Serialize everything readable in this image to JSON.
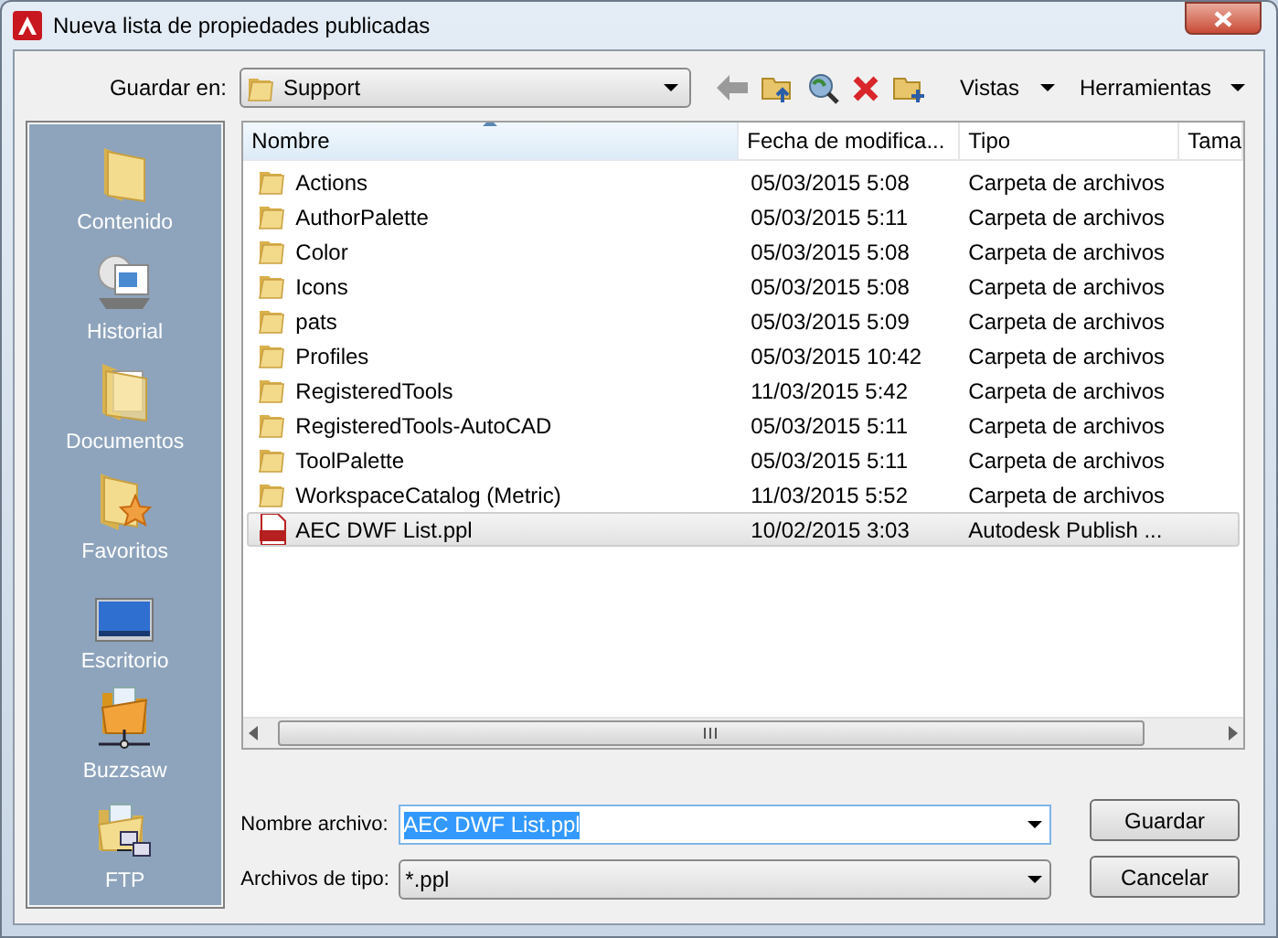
{
  "window": {
    "title": "Nueva lista de propiedades publicadas"
  },
  "save_in": {
    "label": "Guardar en:",
    "value": "Support"
  },
  "toolbar": {
    "views": "Vistas",
    "tools": "Herramientas"
  },
  "sidebar": {
    "items": [
      {
        "label": "Contenido"
      },
      {
        "label": "Historial"
      },
      {
        "label": "Documentos"
      },
      {
        "label": "Favoritos"
      },
      {
        "label": "Escritorio"
      },
      {
        "label": "Buzzsaw"
      },
      {
        "label": "FTP"
      }
    ]
  },
  "table": {
    "columns": [
      {
        "label": "Nombre",
        "sorted": true
      },
      {
        "label": "Fecha de modifica...",
        "sorted": false
      },
      {
        "label": "Tipo",
        "sorted": false
      },
      {
        "label": "Tama",
        "sorted": false
      }
    ],
    "rows": [
      {
        "kind": "folder",
        "name": "Actions",
        "date": "05/03/2015 5:08",
        "type": "Carpeta de archivos",
        "selected": false
      },
      {
        "kind": "folder",
        "name": "AuthorPalette",
        "date": "05/03/2015 5:11",
        "type": "Carpeta de archivos",
        "selected": false
      },
      {
        "kind": "folder",
        "name": "Color",
        "date": "05/03/2015 5:08",
        "type": "Carpeta de archivos",
        "selected": false
      },
      {
        "kind": "folder",
        "name": "Icons",
        "date": "05/03/2015 5:08",
        "type": "Carpeta de archivos",
        "selected": false
      },
      {
        "kind": "folder",
        "name": "pats",
        "date": "05/03/2015 5:09",
        "type": "Carpeta de archivos",
        "selected": false
      },
      {
        "kind": "folder",
        "name": "Profiles",
        "date": "05/03/2015 10:42",
        "type": "Carpeta de archivos",
        "selected": false
      },
      {
        "kind": "folder",
        "name": "RegisteredTools",
        "date": "11/03/2015 5:42",
        "type": "Carpeta de archivos",
        "selected": false
      },
      {
        "kind": "folder",
        "name": "RegisteredTools-AutoCAD",
        "date": "05/03/2015 5:11",
        "type": "Carpeta de archivos",
        "selected": false
      },
      {
        "kind": "folder",
        "name": "ToolPalette",
        "date": "05/03/2015 5:11",
        "type": "Carpeta de archivos",
        "selected": false
      },
      {
        "kind": "folder",
        "name": "WorkspaceCatalog (Metric)",
        "date": "11/03/2015 5:52",
        "type": "Carpeta de archivos",
        "selected": false
      },
      {
        "kind": "file",
        "name": "AEC DWF List.ppl",
        "date": "10/02/2015 3:03",
        "type": "Autodesk Publish ...",
        "selected": true
      }
    ]
  },
  "file_name": {
    "label": "Nombre archivo:",
    "value": "AEC DWF List.ppl"
  },
  "file_type": {
    "label": "Archivos de tipo:",
    "value": "*.ppl"
  },
  "buttons": [
    "Guardar",
    "Cancelar"
  ]
}
